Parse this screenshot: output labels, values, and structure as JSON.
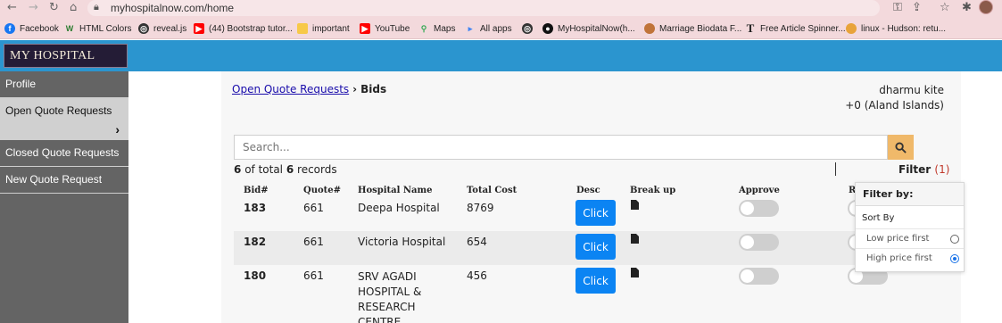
{
  "browser": {
    "url": "myhospitalnow.com/home",
    "bookmarks": [
      {
        "label": "Facebook",
        "color": "#1877f2",
        "icon": "facebook-icon"
      },
      {
        "label": "HTML Colors",
        "color": "#2e7d32",
        "icon": "w-logo-icon"
      },
      {
        "label": "reveal.js",
        "color": "#333333",
        "icon": "globe-icon"
      },
      {
        "label": "(44) Bootstrap tutor...",
        "color": "#ff0000",
        "icon": "youtube-icon"
      },
      {
        "label": "important",
        "color": "#f7c948",
        "icon": "folder-icon"
      },
      {
        "label": "YouTube",
        "color": "#ff0000",
        "icon": "youtube-icon"
      },
      {
        "label": "Maps",
        "color": "#34a853",
        "icon": "maps-icon"
      },
      {
        "label": "All apps",
        "color": "#4285f4",
        "icon": "apps-icon"
      },
      {
        "label": "",
        "color": "#333333",
        "icon": "globe-icon"
      },
      {
        "label": "MyHospitalNow(h...",
        "color": "#111111",
        "icon": "github-icon"
      },
      {
        "label": "Marriage Biodata F...",
        "color": "#c0743a",
        "icon": "person-icon"
      },
      {
        "label": "Free Article Spinner...",
        "color": "#222222",
        "icon": "t-logo-icon"
      },
      {
        "label": "linux - Hudson: retu...",
        "color": "#e8a33a",
        "icon": "person-icon"
      }
    ]
  },
  "app": {
    "logo_text": "MY HOSPITAL NOW",
    "accent_color": "#2b95cf"
  },
  "sidebar": {
    "items": [
      {
        "label": "Profile"
      },
      {
        "label": "Open Quote Requests"
      },
      {
        "label": "Closed Quote Requests"
      },
      {
        "label": "New Quote Request"
      }
    ]
  },
  "breadcrumb": {
    "link": "Open Quote Requests",
    "current": "Bids"
  },
  "user": {
    "name": "dharmu kite",
    "phone": "+0 (Aland Islands)"
  },
  "search": {
    "placeholder": "Search..."
  },
  "records": {
    "shown": "6",
    "total": "6",
    "of_total": "of total",
    "suffix": "records"
  },
  "filter": {
    "label": "Filter",
    "count": "(1)"
  },
  "table": {
    "columns": [
      "Bid#",
      "Quote#",
      "Hospital Name",
      "Total Cost",
      "Desc",
      "Break up",
      "Approve",
      "R"
    ],
    "rows": [
      {
        "bid": "183",
        "quote": "661",
        "hospital": "Deepa Hospital",
        "cost": "8769",
        "button": "Click"
      },
      {
        "bid": "182",
        "quote": "661",
        "hospital": "Victoria Hospital",
        "cost": "654",
        "button": "Click"
      },
      {
        "bid": "180",
        "quote": "661",
        "hospital_lines": [
          "SRV AGADI",
          "HOSPITAL &",
          "RESEARCH",
          "CENTRE"
        ],
        "cost": "456",
        "button": "Click"
      }
    ]
  },
  "filter_popover": {
    "title": "Filter by:",
    "sort_label": "Sort By",
    "options": [
      {
        "label": "Low price first",
        "selected": false
      },
      {
        "label": "High price first",
        "selected": true
      }
    ]
  }
}
